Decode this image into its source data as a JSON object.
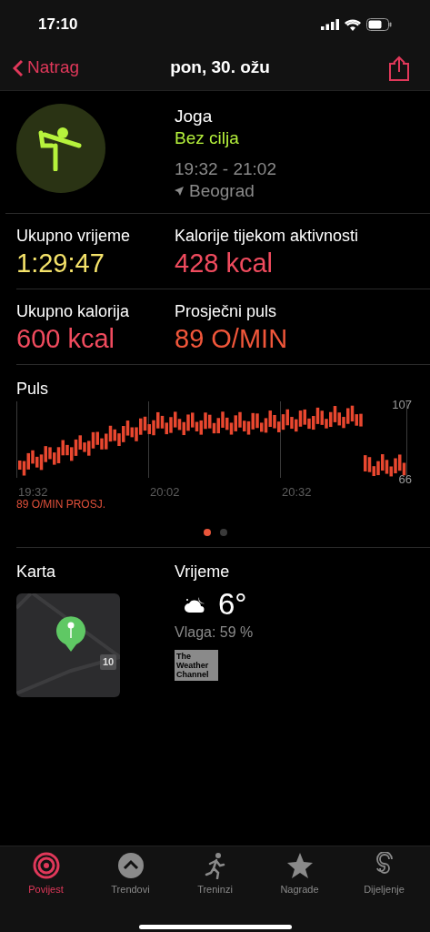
{
  "status_bar": {
    "time": "17:10"
  },
  "nav": {
    "back": "Natrag",
    "title": "pon, 30. ožu"
  },
  "workout": {
    "name": "Joga",
    "goal": "Bez cilja",
    "time_range": "19:32 - 21:02",
    "location": "Beograd"
  },
  "stats": [
    {
      "label": "Ukupno vrijeme",
      "value": "1:29:47",
      "color": "#f5e36a"
    },
    {
      "label": "Kalorije tijekom aktivnosti",
      "value": "428 kcal",
      "color": "#f04b5e"
    },
    {
      "label": "Ukupno kalorija",
      "value": "600 kcal",
      "color": "#f04b5e"
    },
    {
      "label": "Prosječni puls",
      "value": "89 O/MIN",
      "color": "#f0563a"
    }
  ],
  "heart_rate": {
    "title": "Puls",
    "summary": "89 O/MIN PROSJ.",
    "pages": [
      {
        "selected": true
      },
      {
        "selected": false
      }
    ],
    "max_label": "107",
    "min_label": "66",
    "time_labels": [
      "19:32",
      "20:02",
      "20:32"
    ]
  },
  "map": {
    "title": "Karta",
    "road_label": "10"
  },
  "weather": {
    "title": "Vrijeme",
    "temperature": "6°",
    "humidity": "Vlaga: 59 %",
    "provider": "The Weather Channel"
  },
  "tab_bar": [
    {
      "label": "Povijest",
      "kind": "rings",
      "selected": true
    },
    {
      "label": "Trendovi",
      "kind": "trends",
      "selected": false
    },
    {
      "label": "Treninzi",
      "kind": "runner",
      "selected": false
    },
    {
      "label": "Nagrade",
      "kind": "star",
      "selected": false
    },
    {
      "label": "Dijeljenje",
      "kind": "sharing",
      "selected": false
    }
  ]
}
